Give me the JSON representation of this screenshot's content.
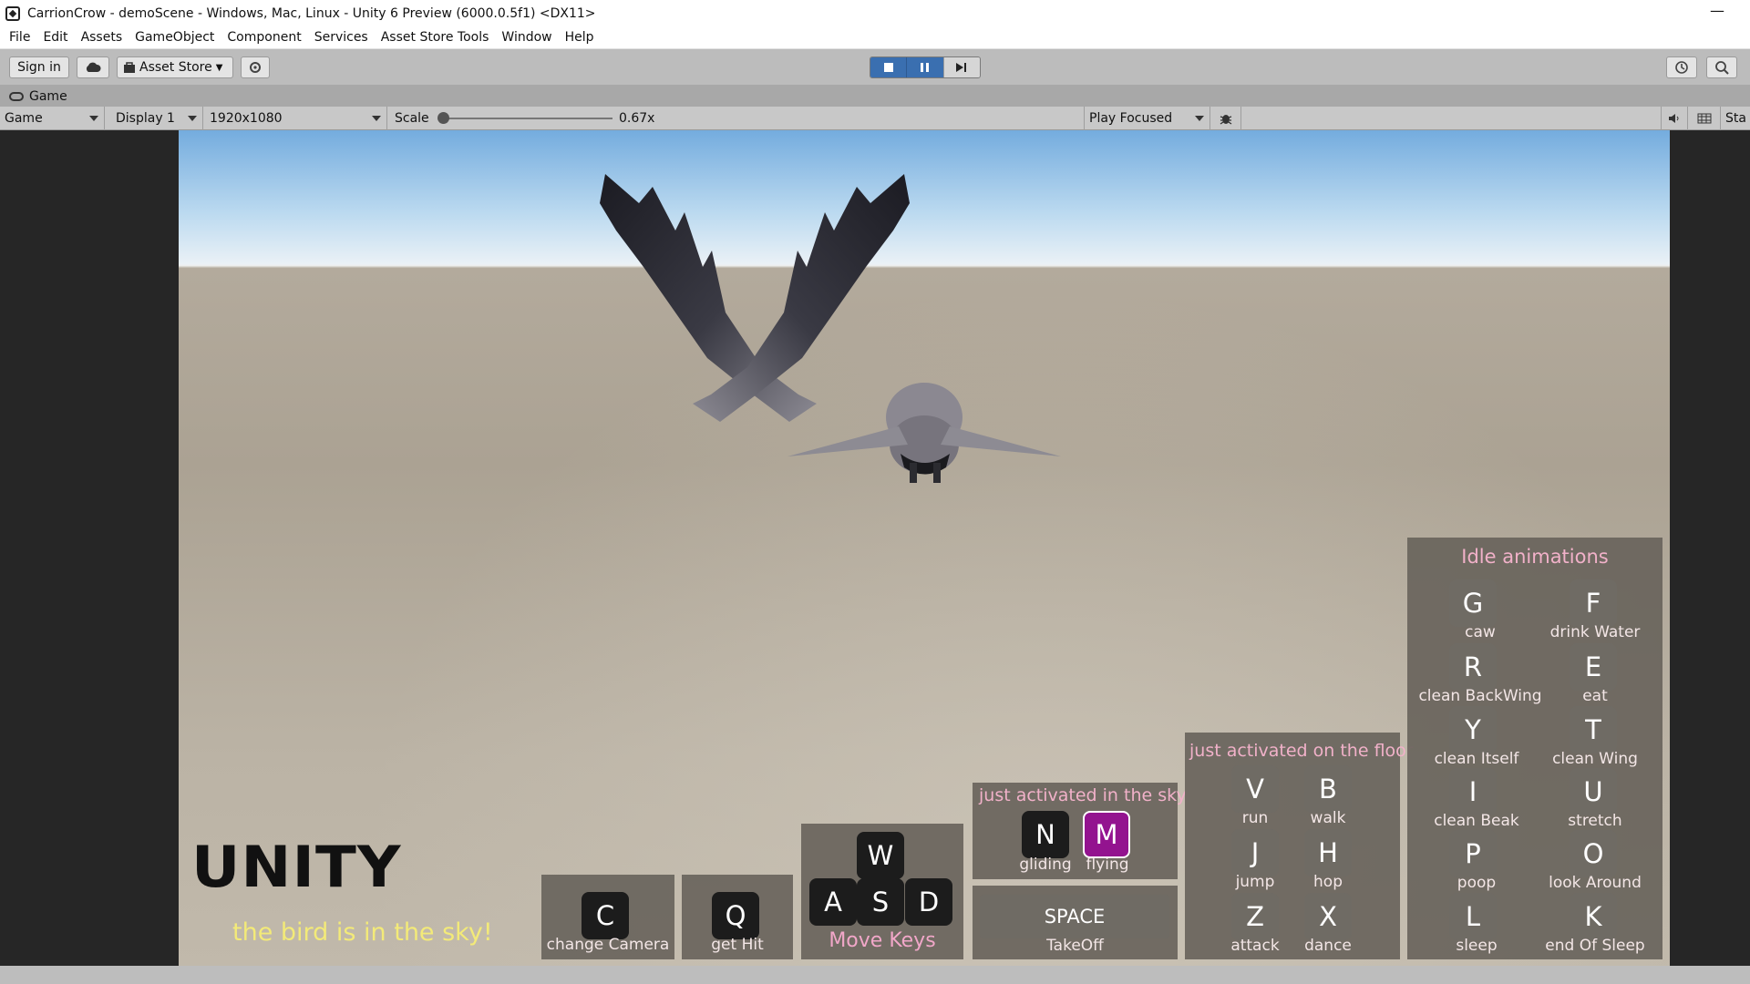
{
  "window": {
    "title": "CarrionCrow - demoScene - Windows, Mac, Linux - Unity 6 Preview (6000.0.5f1) <DX11>",
    "minimize_glyph": "—"
  },
  "menu": [
    "File",
    "Edit",
    "Assets",
    "GameObject",
    "Component",
    "Services",
    "Asset Store Tools",
    "Window",
    "Help"
  ],
  "toolbar": {
    "sign_in": "Sign in",
    "asset_store": "Asset Store"
  },
  "tab": {
    "label": "Game"
  },
  "game_controls": {
    "mode": "Game",
    "display": "Display 1",
    "resolution": "1920x1080",
    "scale_label": "Scale",
    "scale_value": "0.67x",
    "scale_fraction": 0.0,
    "play_mode": "Play Focused",
    "stats_cut": "Sta"
  },
  "hud": {
    "logo": "UNITY",
    "status": "the bird is in the sky!",
    "camera": {
      "key": "C",
      "label": "change Camera"
    },
    "hit": {
      "key": "Q",
      "label": "get Hit"
    },
    "move": {
      "w": "W",
      "a": "A",
      "s": "S",
      "d": "D",
      "label": "Move Keys"
    },
    "sky": {
      "title": "just activated in the sky",
      "n_key": "N",
      "n_label": "gliding",
      "m_key": "M",
      "m_label": "flying"
    },
    "takeoff": {
      "key": "SPACE",
      "label": "TakeOff"
    },
    "floor": {
      "title": "just activated on the floor",
      "keys": [
        {
          "key": "V",
          "label": "run"
        },
        {
          "key": "B",
          "label": "walk"
        },
        {
          "key": "J",
          "label": "jump"
        },
        {
          "key": "H",
          "label": "hop"
        },
        {
          "key": "Z",
          "label": "attack"
        },
        {
          "key": "X",
          "label": "dance"
        }
      ]
    },
    "idle": {
      "title": "Idle animations",
      "keys": [
        {
          "key": "G",
          "label": "caw"
        },
        {
          "key": "F",
          "label": "drink Water"
        },
        {
          "key": "R",
          "label": "clean BackWing"
        },
        {
          "key": "E",
          "label": "eat"
        },
        {
          "key": "Y",
          "label": "clean Itself"
        },
        {
          "key": "T",
          "label": "clean Wing"
        },
        {
          "key": "I",
          "label": "clean Beak"
        },
        {
          "key": "U",
          "label": "stretch"
        },
        {
          "key": "P",
          "label": "poop"
        },
        {
          "key": "O",
          "label": "look Around"
        },
        {
          "key": "L",
          "label": "sleep"
        },
        {
          "key": "K",
          "label": "end Of Sleep"
        }
      ]
    }
  },
  "colors": {
    "play_active": "#3a6fb0",
    "active_key": "#93138f",
    "status_text": "#f3ea78",
    "panel_title": "#f1b1c9"
  }
}
